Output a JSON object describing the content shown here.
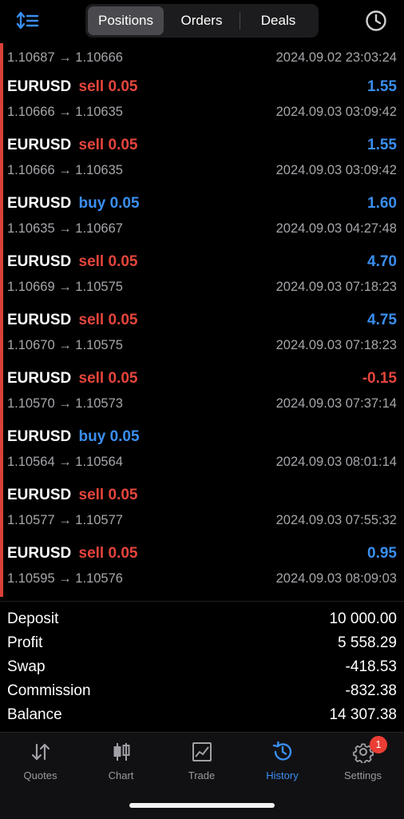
{
  "header": {
    "tabs": [
      {
        "label": "Positions",
        "active": true
      },
      {
        "label": "Orders",
        "active": false
      },
      {
        "label": "Deals",
        "active": false
      }
    ],
    "sort_icon": "sort-icon",
    "history_icon": "clock-icon",
    "accent_color": "#3a8ff0"
  },
  "partial_row": {
    "prices": "1.10687 → 1.10666",
    "time": "2024.09.02 23:03:24"
  },
  "deals": [
    {
      "symbol": "EURUSD",
      "side": "sell",
      "volume": "0.05",
      "profit": "1.55",
      "prices": "1.10666 → 1.10635",
      "time": "2024.09.03 03:09:42"
    },
    {
      "symbol": "EURUSD",
      "side": "sell",
      "volume": "0.05",
      "profit": "1.55",
      "prices": "1.10666 → 1.10635",
      "time": "2024.09.03 03:09:42"
    },
    {
      "symbol": "EURUSD",
      "side": "buy",
      "volume": "0.05",
      "profit": "1.60",
      "prices": "1.10635 → 1.10667",
      "time": "2024.09.03 04:27:48"
    },
    {
      "symbol": "EURUSD",
      "side": "sell",
      "volume": "0.05",
      "profit": "4.70",
      "prices": "1.10669 → 1.10575",
      "time": "2024.09.03 07:18:23"
    },
    {
      "symbol": "EURUSD",
      "side": "sell",
      "volume": "0.05",
      "profit": "4.75",
      "prices": "1.10670 → 1.10575",
      "time": "2024.09.03 07:18:23"
    },
    {
      "symbol": "EURUSD",
      "side": "sell",
      "volume": "0.05",
      "profit": "-0.15",
      "prices": "1.10570 → 1.10573",
      "time": "2024.09.03 07:37:14"
    },
    {
      "symbol": "EURUSD",
      "side": "buy",
      "volume": "0.05",
      "profit": "",
      "prices": "1.10564 → 1.10564",
      "time": "2024.09.03 08:01:14"
    },
    {
      "symbol": "EURUSD",
      "side": "sell",
      "volume": "0.05",
      "profit": "",
      "prices": "1.10577 → 1.10577",
      "time": "2024.09.03 07:55:32"
    },
    {
      "symbol": "EURUSD",
      "side": "sell",
      "volume": "0.05",
      "profit": "0.95",
      "prices": "1.10595 → 1.10576",
      "time": "2024.09.03 08:09:03"
    }
  ],
  "summary": {
    "deposit_label": "Deposit",
    "deposit_value": "10 000.00",
    "profit_label": "Profit",
    "profit_value": "5 558.29",
    "swap_label": "Swap",
    "swap_value": "-418.53",
    "commission_label": "Commission",
    "commission_value": "-832.38",
    "balance_label": "Balance",
    "balance_value": "14 307.38"
  },
  "tabbar": {
    "tabs": [
      {
        "label": "Quotes",
        "icon": "quotes-icon",
        "active": false
      },
      {
        "label": "Chart",
        "icon": "candlestick-chart-icon",
        "active": false
      },
      {
        "label": "Trade",
        "icon": "trade-chart-icon",
        "active": false
      },
      {
        "label": "History",
        "icon": "history-icon",
        "active": true
      },
      {
        "label": "Settings",
        "icon": "gear-icon",
        "active": false,
        "badge": "1"
      }
    ]
  }
}
